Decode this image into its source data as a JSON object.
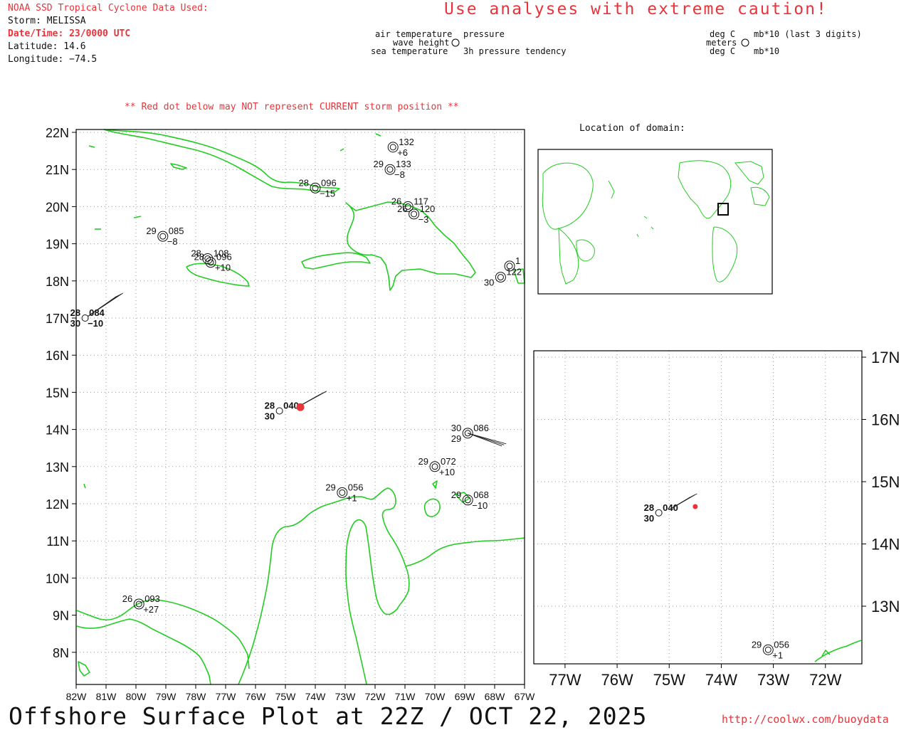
{
  "header": {
    "source": "NOAA SSD Tropical Cyclone Data Used:",
    "storm": "Storm: MELISSA",
    "datetime": "Date/Time: 23/0000 UTC",
    "latitude": "Latitude: 14.6",
    "longitude": "Longitude: −74.5",
    "warning": "Use analyses with extreme caution!"
  },
  "legend": {
    "left": {
      "air_temperature": "air temperature",
      "pressure": "pressure",
      "wave_height": "wave height",
      "sea_temperature": "sea temperature",
      "tendency": "3h pressure tendency"
    },
    "right": {
      "deg_c_top": "deg C",
      "mb_top": "mb*10 (last 3 digits)",
      "meters": "meters",
      "deg_c_bottom": "deg C",
      "mb_bottom": "mb*10"
    }
  },
  "note": "** Red dot below may NOT represent CURRENT storm position **",
  "inset_title": "Location of domain:",
  "footer": {
    "title": "Offshore Surface Plot at 22Z / OCT 22, 2025",
    "url": "http://coolwx.com/buoydata"
  },
  "main_map": {
    "lat_labels": [
      "22N",
      "21N",
      "20N",
      "19N",
      "18N",
      "17N",
      "16N",
      "15N",
      "14N",
      "13N",
      "12N",
      "11N",
      "10N",
      "9N",
      "8N"
    ],
    "lon_labels": [
      "82W",
      "81W",
      "80W",
      "79W",
      "78W",
      "77W",
      "76W",
      "75W",
      "74W",
      "73W",
      "72W",
      "71W",
      "70W",
      "69W",
      "68W",
      "67W"
    ]
  },
  "zoom_map": {
    "lat_labels": [
      "17N",
      "16N",
      "15N",
      "14N",
      "13N"
    ],
    "lon_labels": [
      "77W",
      "76W",
      "75W",
      "74W",
      "73W",
      "72W"
    ]
  },
  "storm_position": {
    "lat": 14.6,
    "lon": -74.5,
    "color": "#e8343a"
  },
  "stations": [
    {
      "lat": 21.6,
      "lon": -71.4,
      "left_top": "",
      "right_top": "132",
      "right_bottom": "+6",
      "left_bottom": ""
    },
    {
      "lat": 21.0,
      "lon": -71.5,
      "left_top": "29",
      "right_top": "133",
      "right_bottom": "−8",
      "left_bottom": ""
    },
    {
      "lat": 20.5,
      "lon": -74.0,
      "left_top": "28",
      "right_top": "096",
      "right_bottom": "−15",
      "left_bottom": ""
    },
    {
      "lat": 20.0,
      "lon": -70.9,
      "left_top": "26",
      "right_top": "117",
      "right_bottom": "",
      "left_bottom": ""
    },
    {
      "lat": 19.8,
      "lon": -70.7,
      "left_top": "26",
      "right_top": "120",
      "right_bottom": "−3",
      "left_bottom": ""
    },
    {
      "lat": 19.2,
      "lon": -79.1,
      "left_top": "29",
      "right_top": "085",
      "right_bottom": "−8",
      "left_bottom": ""
    },
    {
      "lat": 18.6,
      "lon": -77.6,
      "left_top": "28",
      "right_top": "108",
      "right_bottom": "",
      "left_bottom": ""
    },
    {
      "lat": 18.5,
      "lon": -77.5,
      "left_top": "28",
      "right_top": "096",
      "right_bottom": "+10",
      "left_bottom": ""
    },
    {
      "lat": 17.0,
      "lon": -81.7,
      "left_top": "28",
      "right_top": "084",
      "right_bottom": "−10",
      "left_bottom": "30"
    },
    {
      "lat": 14.5,
      "lon": -75.2,
      "left_top": "28",
      "right_top": "040",
      "right_bottom": "",
      "left_bottom": "30"
    },
    {
      "lat": 13.9,
      "lon": -68.9,
      "left_top": "30",
      "right_top": "086",
      "right_bottom": "",
      "left_bottom": "29"
    },
    {
      "lat": 13.0,
      "lon": -70.0,
      "left_top": "29",
      "right_top": "072",
      "right_bottom": "+10",
      "left_bottom": ""
    },
    {
      "lat": 12.3,
      "lon": -73.1,
      "left_top": "29",
      "right_top": "056",
      "right_bottom": "+1",
      "left_bottom": ""
    },
    {
      "lat": 12.1,
      "lon": -68.9,
      "left_top": "29",
      "right_top": "068",
      "right_bottom": "−10",
      "left_bottom": ""
    },
    {
      "lat": 9.3,
      "lon": -79.9,
      "left_top": "26",
      "right_top": "093",
      "right_bottom": "+27",
      "left_bottom": ""
    },
    {
      "lat": 18.4,
      "lon": -67.5,
      "left_top": "",
      "right_top": "1",
      "right_bottom": "",
      "left_bottom": ""
    },
    {
      "lat": 18.1,
      "lon": -67.8,
      "left_top": "",
      "right_top": "122",
      "right_bottom": "",
      "left_bottom": "30"
    }
  ],
  "map_colors": {
    "coast": "#22cc22",
    "grid": "#999999",
    "frame": "#000000"
  }
}
